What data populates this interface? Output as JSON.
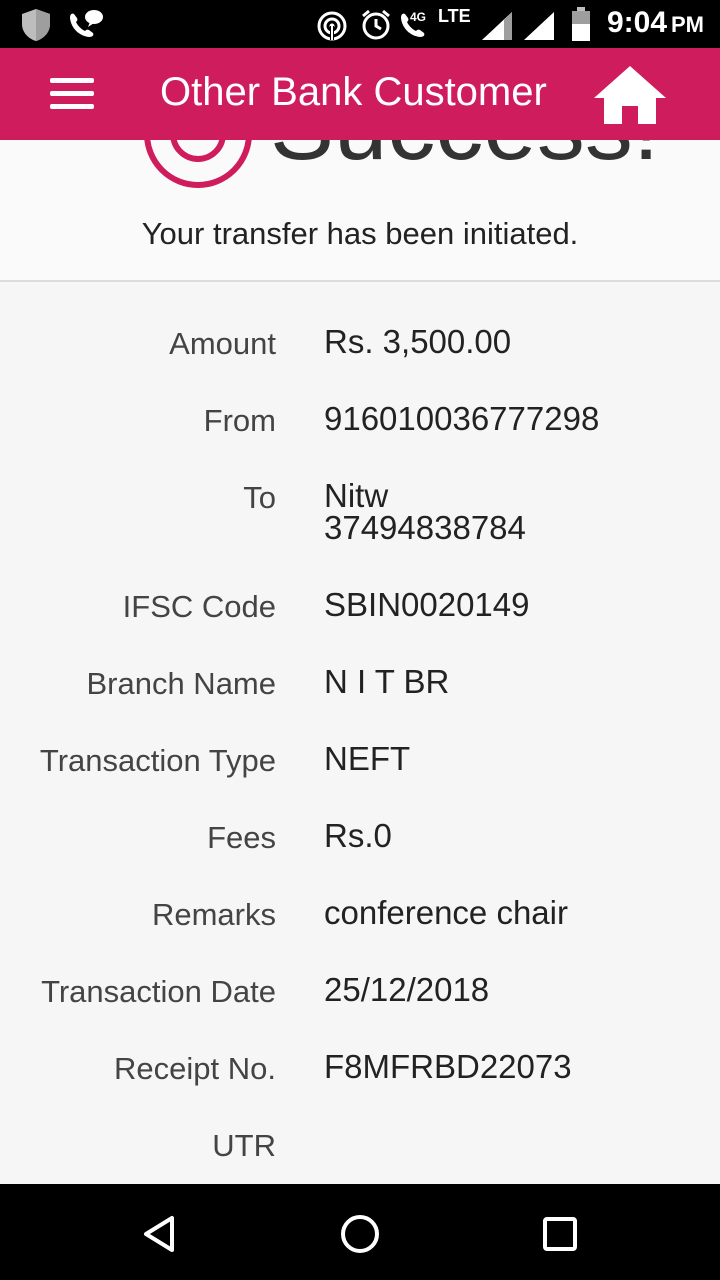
{
  "status_bar": {
    "network_small": "4G",
    "network_label": "LTE",
    "time": "9:04",
    "ampm": "PM",
    "icons": [
      "shield-icon",
      "voicemail-icon",
      "hotspot-icon",
      "alarm-icon",
      "wifi-call-icon",
      "signal-icon",
      "signal-icon",
      "battery-icon"
    ]
  },
  "app_bar": {
    "title": "Other Bank Customer",
    "menu_icon": "hamburger-menu-icon",
    "home_icon": "home-icon",
    "color": "#cf1c5d"
  },
  "success": {
    "heading": "Success!",
    "message": "Your transfer has been initiated.",
    "icon": "success-check-icon"
  },
  "details": [
    {
      "label": "Amount",
      "value": "Rs. 3,500.00"
    },
    {
      "label": "From",
      "value": "916010036777298"
    },
    {
      "label": "To",
      "value_lines": [
        "Nitw",
        "37494838784"
      ]
    },
    {
      "label": "IFSC Code",
      "value": "SBIN0020149"
    },
    {
      "label": "Branch Name",
      "value": "N I T BR"
    },
    {
      "label": "Transaction Type",
      "value": "NEFT"
    },
    {
      "label": "Fees",
      "value": "Rs.0"
    },
    {
      "label": "Remarks",
      "value": "conference chair"
    },
    {
      "label": "Transaction Date",
      "value": "25/12/2018"
    },
    {
      "label": "Receipt No.",
      "value": "F8MFRBD22073"
    },
    {
      "label": "UTR",
      "value": ""
    }
  ],
  "nav_bar": {
    "back_icon": "back-triangle-icon",
    "home_icon": "home-circle-icon",
    "recents_icon": "recents-square-icon"
  }
}
